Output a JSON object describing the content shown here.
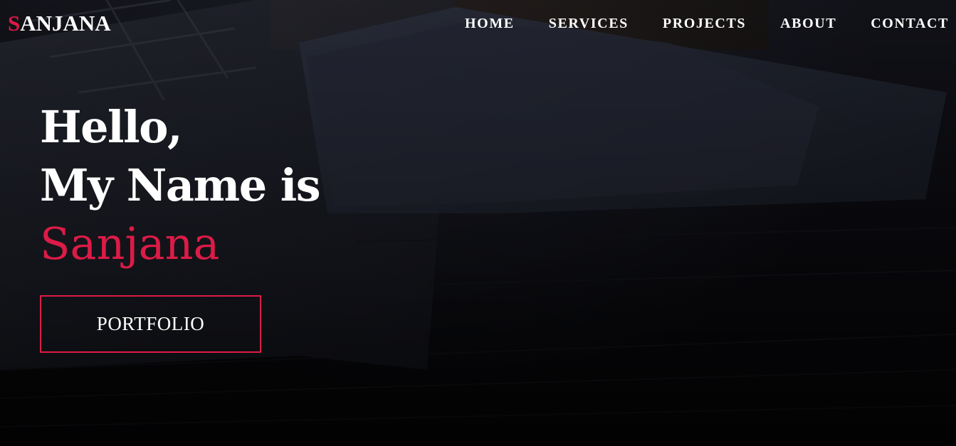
{
  "brand": {
    "first_letter": "S",
    "rest": "ANJANA",
    "accent_color": "#dc1b46"
  },
  "nav": {
    "items": [
      {
        "label": "HOME"
      },
      {
        "label": "SERVICES"
      },
      {
        "label": "PROJECTS"
      },
      {
        "label": "ABOUT"
      },
      {
        "label": "CONTACT"
      }
    ]
  },
  "hero": {
    "greeting": "Hello,",
    "intro": "My Name is",
    "name": "Sanjana",
    "button_label": "PORTFOLIO",
    "background": "dark desk photo with laptop and smartphone"
  }
}
